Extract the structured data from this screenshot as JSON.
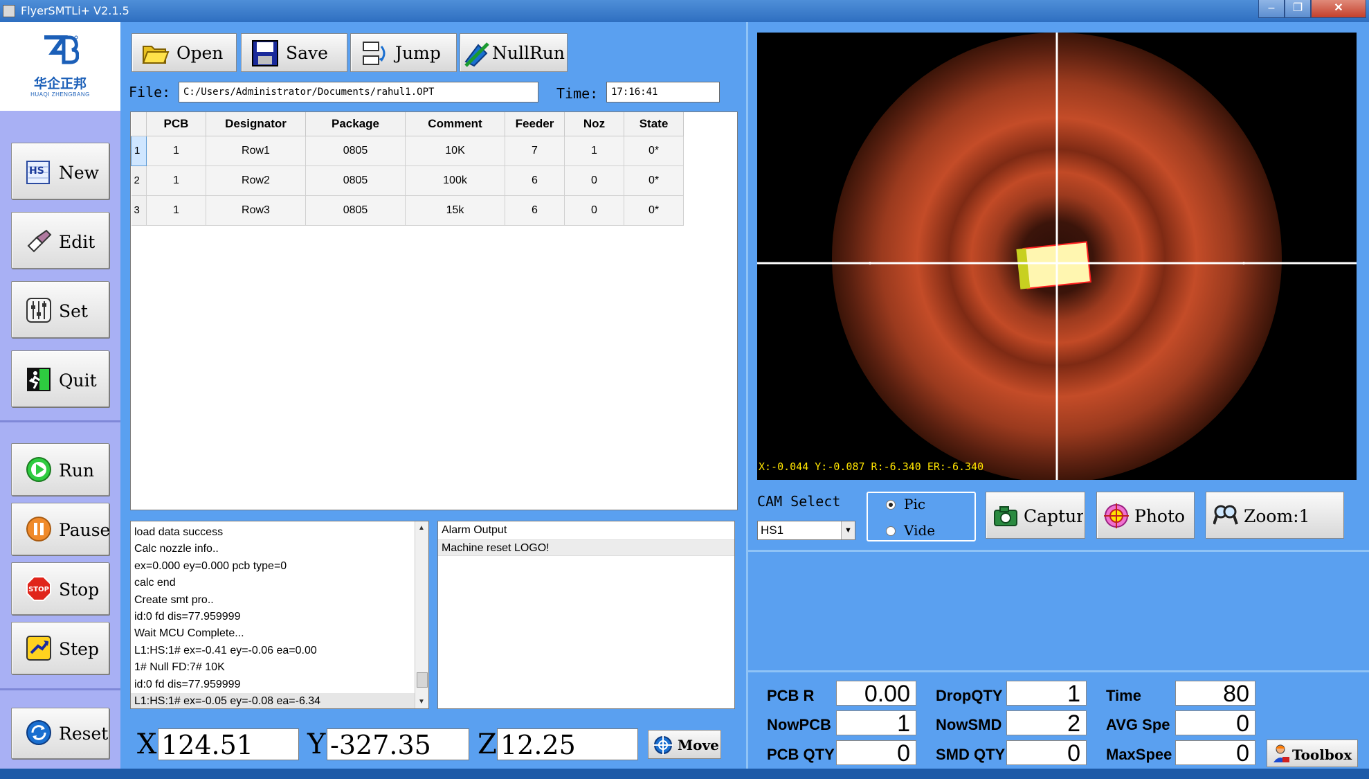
{
  "window": {
    "title": "FlyerSMTLi+ V2.1.5",
    "min": "–",
    "max": "❐",
    "close": "✕"
  },
  "logo": {
    "cn": "华企正邦",
    "en": "HUAQI ZHENGBANG"
  },
  "sidebar": {
    "new": "New",
    "edit": "Edit",
    "set": "Set",
    "quit": "Quit",
    "run": "Run",
    "pause": "Pause",
    "stop": "Stop",
    "step": "Step",
    "reset": "Reset",
    "stop_icon_text": "STOP",
    "hs_icon_text": "HS"
  },
  "toolbar": {
    "open": "Open",
    "save": "Save",
    "jump": "Jump",
    "nullrun": "NullRun"
  },
  "file": {
    "label": "File:",
    "value": "C:/Users/Administrator/Documents/rahul1.OPT"
  },
  "time": {
    "label": "Time:",
    "value": "17:16:41"
  },
  "grid": {
    "headers": [
      "PCB",
      "Designator",
      "Package",
      "Comment",
      "Feeder",
      "Noz",
      "State"
    ],
    "rows": [
      {
        "n": "1",
        "pcb": "1",
        "designator": "Row1",
        "package": "0805",
        "comment": "10K",
        "feeder": "7",
        "noz": "1",
        "state": "0*"
      },
      {
        "n": "2",
        "pcb": "1",
        "designator": "Row2",
        "package": "0805",
        "comment": "100k",
        "feeder": "6",
        "noz": "0",
        "state": "0*"
      },
      {
        "n": "3",
        "pcb": "1",
        "designator": "Row3",
        "package": "0805",
        "comment": "15k",
        "feeder": "6",
        "noz": "0",
        "state": "0*"
      }
    ]
  },
  "log": [
    "load data success",
    "Calc nozzle info..",
    "ex=0.000 ey=0.000 pcb type=0",
    "calc end",
    "Create smt pro..",
    "id:0 fd dis=77.959999",
    "Wait MCU Complete...",
    "L1:HS:1# ex=-0.41 ey=-0.06 ea=0.00",
    "1# Null FD:7# 10K",
    "id:0 fd dis=77.959999",
    "L1:HS:1# ex=-0.05 ey=-0.08 ea=-6.34"
  ],
  "alarm": {
    "header": "Alarm Output",
    "items": [
      "Machine reset LOGO!"
    ]
  },
  "coords": {
    "x_label": "X",
    "x": "124.51",
    "y_label": "Y",
    "y": "-327.35",
    "z_label": "Z",
    "z": "12.25",
    "move": "Move"
  },
  "camera": {
    "readout": "X:-0.044 Y:-0.087 R:-6.340 ER:-6.340",
    "select_label": "CAM Select",
    "selected": "HS1",
    "mode_pic": "Pic",
    "mode_video": "Vide",
    "capture": "Captur",
    "photo": "Photo",
    "zoom": "Zoom:1"
  },
  "stats": {
    "pcb_r": {
      "label": "PCB R",
      "value": "0.00"
    },
    "now_pcb": {
      "label": "NowPCB",
      "value": "1"
    },
    "pcb_qty": {
      "label": "PCB QTY",
      "value": "0"
    },
    "drop_qty": {
      "label": "DropQTY",
      "value": "1"
    },
    "now_smd": {
      "label": "NowSMD",
      "value": "2"
    },
    "smd_qty": {
      "label": "SMD QTY",
      "value": "0"
    },
    "time": {
      "label": "Time",
      "value": "80"
    },
    "avg_spe": {
      "label": "AVG Spe",
      "value": "0"
    },
    "max_spee": {
      "label": "MaxSpee",
      "value": "0"
    },
    "toolbox": "Toolbox"
  },
  "colors": {
    "background": "#5aa0f0",
    "sidebar": "#a8b0f4",
    "titlebar": "#2e6fc0",
    "readout": "#ffe400"
  }
}
